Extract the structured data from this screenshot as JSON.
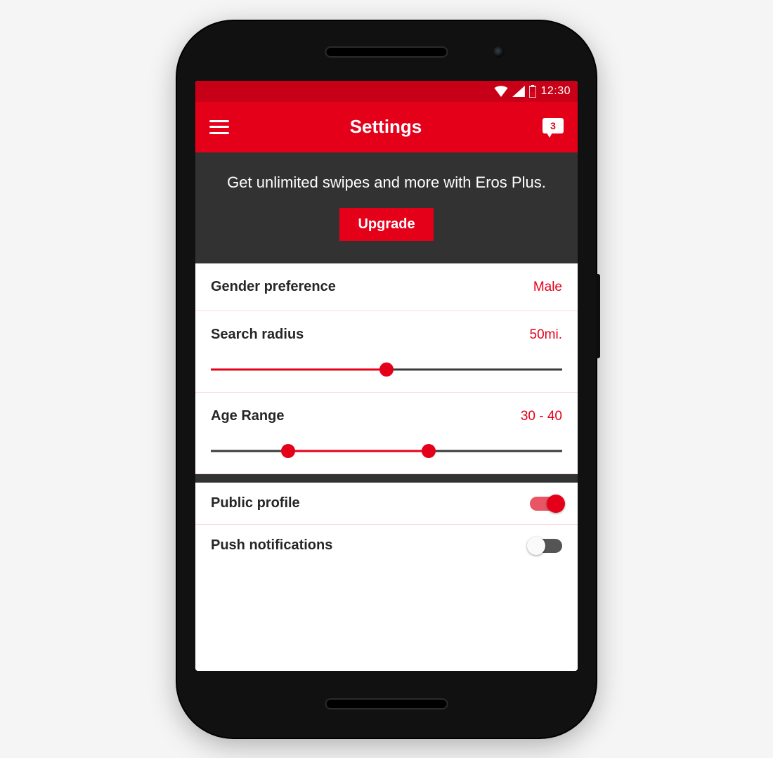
{
  "status": {
    "time": "12:30"
  },
  "header": {
    "title": "Settings",
    "message_count": "3"
  },
  "promo": {
    "text": "Get unlimited swipes and more with Eros Plus.",
    "button": "Upgrade"
  },
  "settings": {
    "gender": {
      "label": "Gender preference",
      "value": "Male"
    },
    "radius": {
      "label": "Search radius",
      "value": "50mi.",
      "percent": 50
    },
    "age": {
      "label": "Age Range",
      "value": "30 - 40",
      "low_percent": 22,
      "high_percent": 62
    },
    "public_profile": {
      "label": "Public profile",
      "on": true
    },
    "push": {
      "label": "Push notifications",
      "on": false
    }
  }
}
